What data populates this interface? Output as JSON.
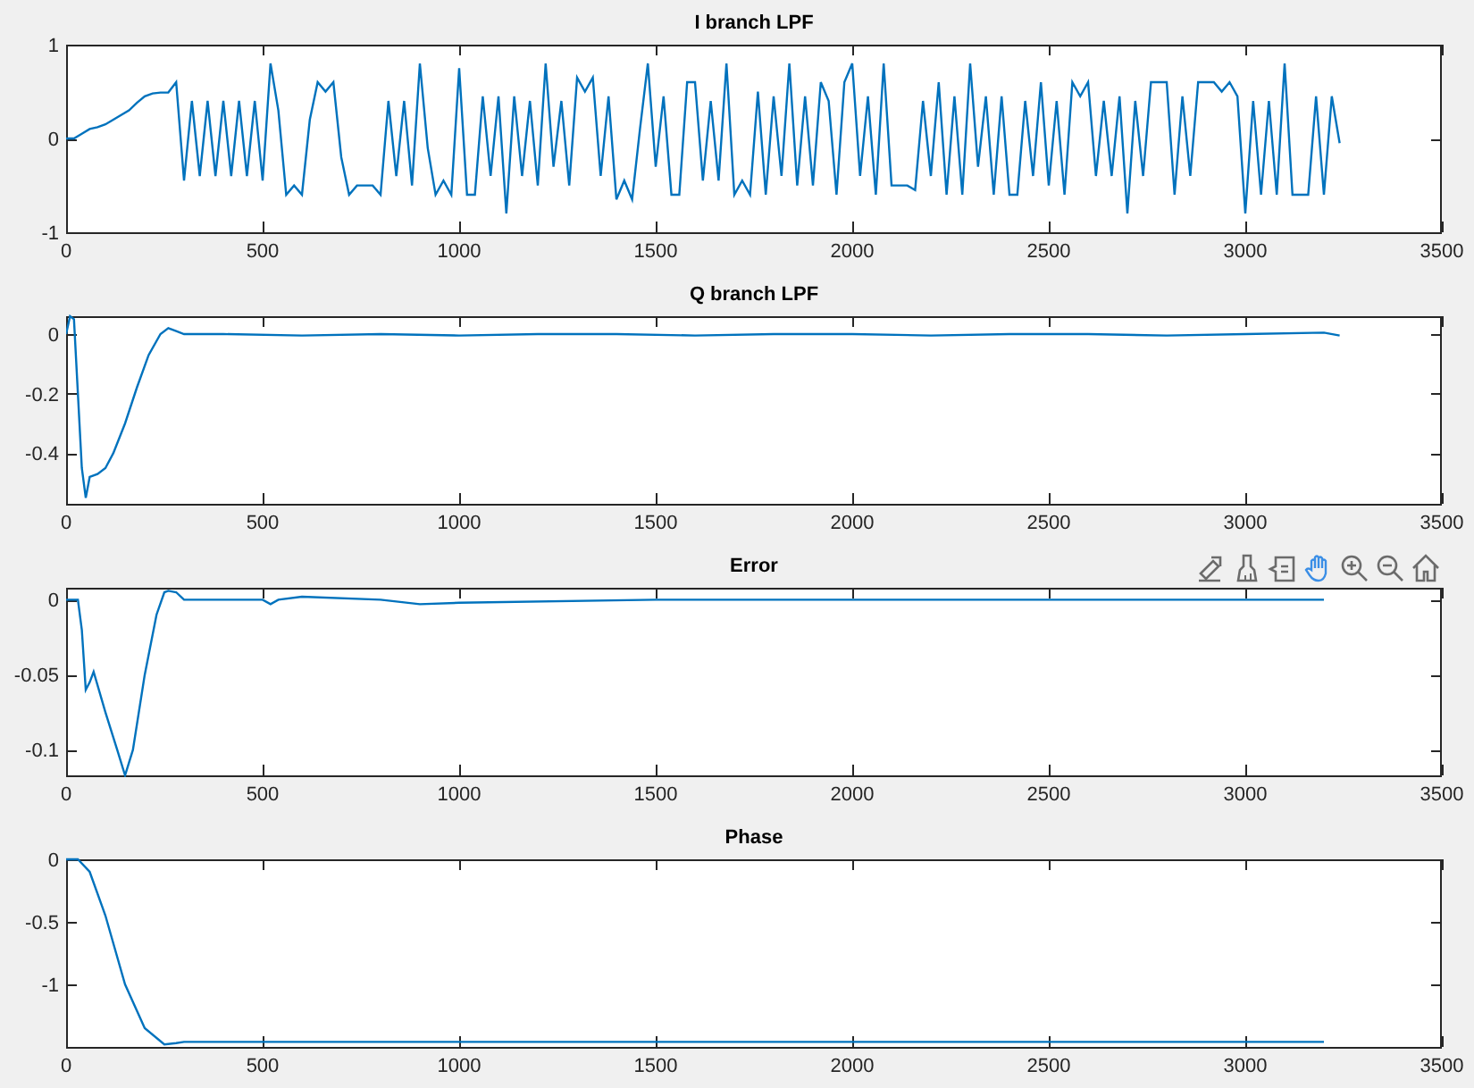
{
  "plots": [
    {
      "chart_data": {
        "type": "line",
        "title": "I branch LPF",
        "xlim": [
          0,
          3500
        ],
        "ylim": [
          -1,
          1
        ],
        "xticks": [
          0,
          500,
          1000,
          1500,
          2000,
          2500,
          3000,
          3500
        ],
        "yticks": [
          -1,
          0,
          1
        ],
        "x": [
          0,
          20,
          40,
          60,
          80,
          100,
          120,
          140,
          160,
          180,
          200,
          220,
          240,
          260,
          280,
          300,
          320,
          340,
          360,
          380,
          400,
          420,
          440,
          460,
          480,
          500,
          520,
          540,
          560,
          580,
          600,
          620,
          640,
          660,
          680,
          700,
          720,
          740,
          760,
          780,
          800,
          820,
          840,
          860,
          880,
          900,
          920,
          940,
          960,
          980,
          1000,
          1020,
          1040,
          1060,
          1080,
          1100,
          1120,
          1140,
          1160,
          1180,
          1200,
          1220,
          1240,
          1260,
          1280,
          1300,
          1320,
          1340,
          1360,
          1380,
          1400,
          1420,
          1440,
          1460,
          1480,
          1500,
          1520,
          1540,
          1560,
          1580,
          1600,
          1620,
          1640,
          1660,
          1680,
          1700,
          1720,
          1740,
          1760,
          1780,
          1800,
          1820,
          1840,
          1860,
          1880,
          1900,
          1920,
          1940,
          1960,
          1980,
          2000,
          2020,
          2040,
          2060,
          2080,
          2100,
          2120,
          2140,
          2160,
          2180,
          2200,
          2220,
          2240,
          2260,
          2280,
          2300,
          2320,
          2340,
          2360,
          2380,
          2400,
          2420,
          2440,
          2460,
          2480,
          2500,
          2520,
          2540,
          2560,
          2580,
          2600,
          2620,
          2640,
          2660,
          2680,
          2700,
          2720,
          2740,
          2760,
          2780,
          2800,
          2820,
          2840,
          2860,
          2880,
          2900,
          2920,
          2940,
          2960,
          2980,
          3000,
          3020,
          3040,
          3060,
          3080,
          3100,
          3120,
          3140,
          3160,
          3180,
          3200,
          3220,
          3240
        ],
        "series": [
          {
            "color": "#0072bd",
            "values": [
              0,
              0,
              0.05,
              0.1,
              0.12,
              0.15,
              0.2,
              0.25,
              0.3,
              0.38,
              0.45,
              0.48,
              0.49,
              0.49,
              0.6,
              -0.45,
              0.4,
              -0.4,
              0.4,
              -0.4,
              0.4,
              -0.4,
              0.4,
              -0.4,
              0.4,
              -0.45,
              0.8,
              0.3,
              -0.6,
              -0.5,
              -0.6,
              0.2,
              0.6,
              0.5,
              0.6,
              -0.2,
              -0.6,
              -0.5,
              -0.5,
              -0.5,
              -0.6,
              0.4,
              -0.4,
              0.4,
              -0.5,
              0.8,
              -0.1,
              -0.6,
              -0.45,
              -0.6,
              0.75,
              -0.6,
              -0.6,
              0.45,
              -0.4,
              0.45,
              -0.8,
              0.45,
              -0.4,
              0.4,
              -0.5,
              0.8,
              -0.3,
              0.4,
              -0.5,
              0.65,
              0.5,
              0.65,
              -0.4,
              0.45,
              -0.65,
              -0.45,
              -0.65,
              0.1,
              0.8,
              -0.3,
              0.45,
              -0.6,
              -0.6,
              0.6,
              0.6,
              -0.45,
              0.4,
              -0.45,
              0.8,
              -0.6,
              -0.45,
              -0.6,
              0.5,
              -0.6,
              0.45,
              -0.4,
              0.8,
              -0.5,
              0.45,
              -0.5,
              0.6,
              0.4,
              -0.6,
              0.6,
              0.8,
              -0.4,
              0.45,
              -0.6,
              0.8,
              -0.5,
              -0.5,
              -0.5,
              -0.55,
              0.4,
              -0.4,
              0.6,
              -0.6,
              0.45,
              -0.6,
              0.8,
              -0.3,
              0.45,
              -0.6,
              0.45,
              -0.6,
              -0.6,
              0.4,
              -0.4,
              0.6,
              -0.5,
              0.4,
              -0.6,
              0.6,
              0.45,
              0.6,
              -0.4,
              0.4,
              -0.4,
              0.45,
              -0.8,
              0.4,
              -0.4,
              0.6,
              0.6,
              0.6,
              -0.6,
              0.45,
              -0.4,
              0.6,
              0.6,
              0.6,
              0.5,
              0.6,
              0.45,
              -0.8,
              0.4,
              -0.6,
              0.4,
              -0.6,
              0.8,
              -0.6,
              -0.6,
              -0.6,
              0.45,
              -0.6,
              0.45,
              -0.05
            ]
          }
        ]
      }
    },
    {
      "chart_data": {
        "type": "line",
        "title": "Q branch LPF",
        "xlim": [
          0,
          3500
        ],
        "ylim": [
          -0.57,
          0.06
        ],
        "xticks": [
          0,
          500,
          1000,
          1500,
          2000,
          2500,
          3000,
          3500
        ],
        "yticks": [
          -0.4,
          -0.2,
          0
        ],
        "x": [
          0,
          10,
          20,
          30,
          40,
          50,
          60,
          80,
          100,
          120,
          150,
          180,
          210,
          240,
          260,
          280,
          300,
          400,
          600,
          800,
          1000,
          1200,
          1400,
          1600,
          1800,
          2000,
          2200,
          2400,
          2600,
          2800,
          3000,
          3200,
          3240
        ],
        "series": [
          {
            "color": "#0072bd",
            "values": [
              0,
              0.06,
              0.05,
              -0.2,
              -0.45,
              -0.55,
              -0.48,
              -0.47,
              -0.45,
              -0.4,
              -0.3,
              -0.18,
              -0.07,
              0,
              0.02,
              0.01,
              0,
              0,
              -0.005,
              0,
              -0.005,
              0,
              0,
              -0.005,
              0,
              0,
              -0.005,
              0,
              0,
              -0.005,
              0,
              0.005,
              -0.005
            ]
          }
        ]
      }
    },
    {
      "chart_data": {
        "type": "line",
        "title": "Error",
        "xlim": [
          0,
          3500
        ],
        "ylim": [
          -0.117,
          0.008
        ],
        "xticks": [
          0,
          500,
          1000,
          1500,
          2000,
          2500,
          3000,
          3500
        ],
        "yticks": [
          -0.1,
          -0.05,
          0
        ],
        "x": [
          0,
          30,
          40,
          50,
          60,
          70,
          100,
          130,
          150,
          170,
          200,
          230,
          250,
          260,
          280,
          300,
          500,
          520,
          540,
          600,
          800,
          900,
          1000,
          1500,
          2000,
          2500,
          3000,
          3200
        ],
        "series": [
          {
            "color": "#0072bd",
            "values": [
              0,
              0,
              -0.02,
              -0.06,
              -0.055,
              -0.048,
              -0.075,
              -0.1,
              -0.117,
              -0.1,
              -0.05,
              -0.01,
              0.005,
              0.006,
              0.005,
              0,
              0,
              -0.003,
              0,
              0.002,
              0,
              -0.003,
              -0.002,
              0,
              0,
              0,
              0,
              0
            ]
          }
        ]
      }
    },
    {
      "chart_data": {
        "type": "line",
        "title": "Phase",
        "xlim": [
          0,
          3500
        ],
        "ylim": [
          -1.5,
          0
        ],
        "xticks": [
          0,
          500,
          1000,
          1500,
          2000,
          2500,
          3000,
          3500
        ],
        "yticks": [
          -1,
          -0.5,
          0
        ],
        "x": [
          0,
          30,
          60,
          100,
          150,
          200,
          250,
          280,
          300,
          1000,
          2000,
          3000,
          3200
        ],
        "series": [
          {
            "color": "#0072bd",
            "values": [
              0,
              0,
              -0.1,
              -0.45,
              -1.0,
              -1.35,
              -1.48,
              -1.47,
              -1.46,
              -1.46,
              -1.46,
              -1.46,
              -1.46
            ]
          }
        ]
      }
    }
  ],
  "toolbar": [
    {
      "kind": "export",
      "selected": false
    },
    {
      "kind": "brush",
      "selected": false
    },
    {
      "kind": "datatip",
      "selected": false
    },
    {
      "kind": "pan",
      "selected": true
    },
    {
      "kind": "zoomin",
      "selected": false
    },
    {
      "kind": "zoomout",
      "selected": false
    },
    {
      "kind": "home",
      "selected": false
    }
  ]
}
